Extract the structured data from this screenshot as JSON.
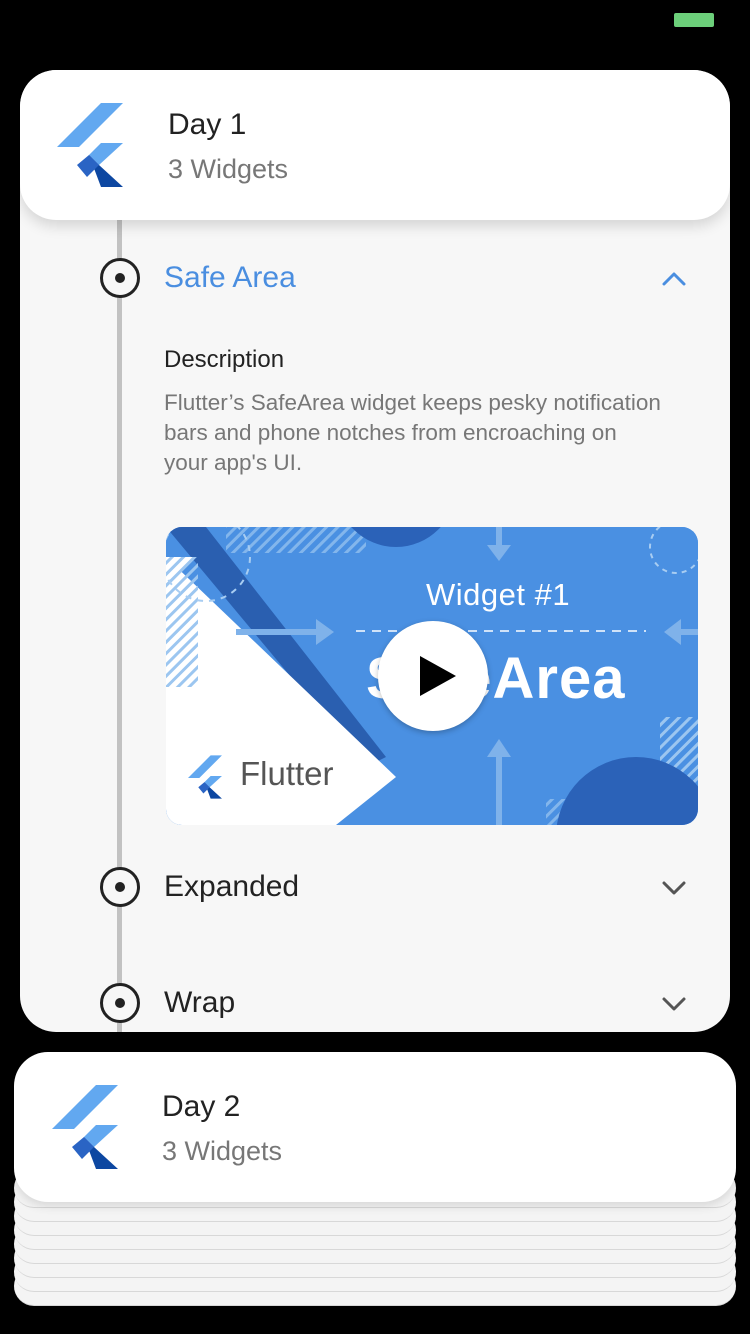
{
  "colors": {
    "accent": "#4a8ee0",
    "battery": "#6ccf7a",
    "timeline": "#c2c2c2",
    "video_bg": "#4a90e2"
  },
  "status_bar": {
    "battery_icon": "battery-icon"
  },
  "days": [
    {
      "title": "Day 1",
      "subtitle": "3 Widgets",
      "items": [
        {
          "title": "Safe Area",
          "expanded": true,
          "description_heading": "Description",
          "description": "Flutter’s SafeArea widget keeps pesky notification bars and phone notches from encroaching on your app's UI.",
          "video": {
            "label": "Widget #1",
            "title": "SafeArea",
            "brand": "Flutter",
            "play_icon": "play-icon"
          }
        },
        {
          "title": "Expanded",
          "expanded": false
        },
        {
          "title": "Wrap",
          "expanded": false
        }
      ]
    },
    {
      "title": "Day 2",
      "subtitle": "3 Widgets"
    }
  ]
}
